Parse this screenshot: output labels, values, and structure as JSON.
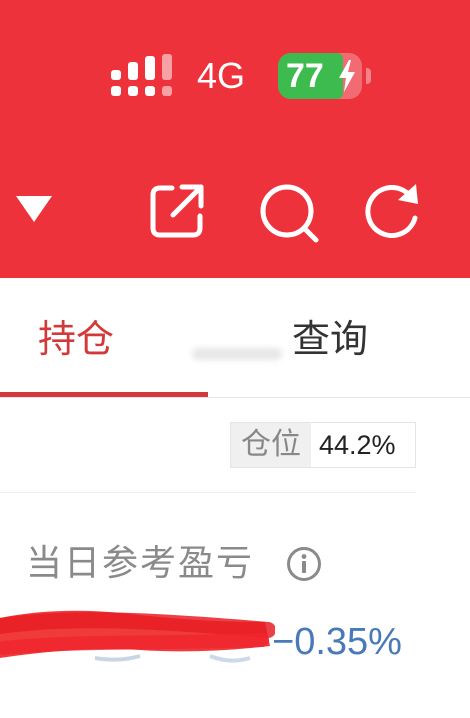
{
  "status_bar": {
    "network": "4G",
    "battery_level": 77,
    "battery_label": "77",
    "battery_color": "#3dbb4f"
  },
  "header": {
    "background_color": "#ee323c",
    "icons": [
      "dropdown-icon",
      "share-icon",
      "search-icon",
      "refresh-icon"
    ]
  },
  "tabs": [
    {
      "label": "持仓",
      "active": true
    },
    {
      "label": "查询",
      "active": false
    }
  ],
  "position_ratio": {
    "label": "仓位",
    "value": "44.2%"
  },
  "daily_pnl": {
    "label": "当日参考盈亏",
    "percent": "−0.35%",
    "percent_color": "#4a79b8"
  }
}
